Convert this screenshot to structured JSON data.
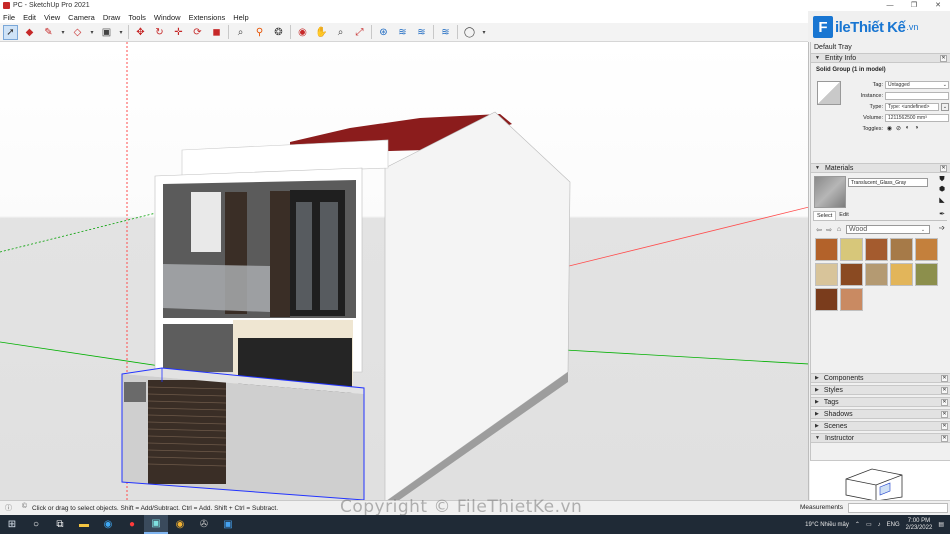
{
  "window": {
    "title": "PC - SketchUp Pro 2021",
    "controls": [
      "—",
      "❐",
      "✕"
    ]
  },
  "menu": [
    "File",
    "Edit",
    "View",
    "Camera",
    "Draw",
    "Tools",
    "Window",
    "Extensions",
    "Help"
  ],
  "logo": {
    "mark": "F",
    "text": "ileThiết Kế",
    "ext": ".vn"
  },
  "tray": {
    "title": "Default Tray",
    "entity_info": {
      "header": "Entity Info",
      "name": "Solid Group (1 in model)",
      "tag_label": "Tag:",
      "tag_value": "Untagged",
      "instance_label": "Instance:",
      "instance_value": "",
      "type_label": "Type:",
      "type_value": "Type: <undefined>",
      "volume_label": "Volume:",
      "volume_value": "1211562500 mm³",
      "toggles_label": "Toggles:"
    },
    "materials": {
      "header": "Materials",
      "current": "Translucent_Glass_Gray",
      "tab_select": "Select",
      "tab_edit": "Edit",
      "library": "Wood",
      "swatches": [
        "#b3622a",
        "#d7c77a",
        "#a45b2e",
        "#a67a48",
        "#c4803c",
        "#d8c49a",
        "#8a4a22",
        "#b49a72",
        "#e2b55a",
        "#8c8f4c",
        "#7a3c1c",
        "#c98a62"
      ]
    },
    "panels": [
      "Components",
      "Styles",
      "Tags",
      "Shadows",
      "Scenes",
      "Instructor"
    ]
  },
  "status": {
    "hint": "Click or drag to select objects. Shift = Add/Subtract. Ctrl = Add. Shift + Ctrl = Subtract.",
    "measurements_label": "Measurements"
  },
  "watermark": "Copyright © FileThietKe.vn",
  "taskbar": {
    "weather": "19°C  Nhiều mây",
    "lang": "ENG",
    "time": "7:00 PM",
    "date": "2/23/2022"
  }
}
